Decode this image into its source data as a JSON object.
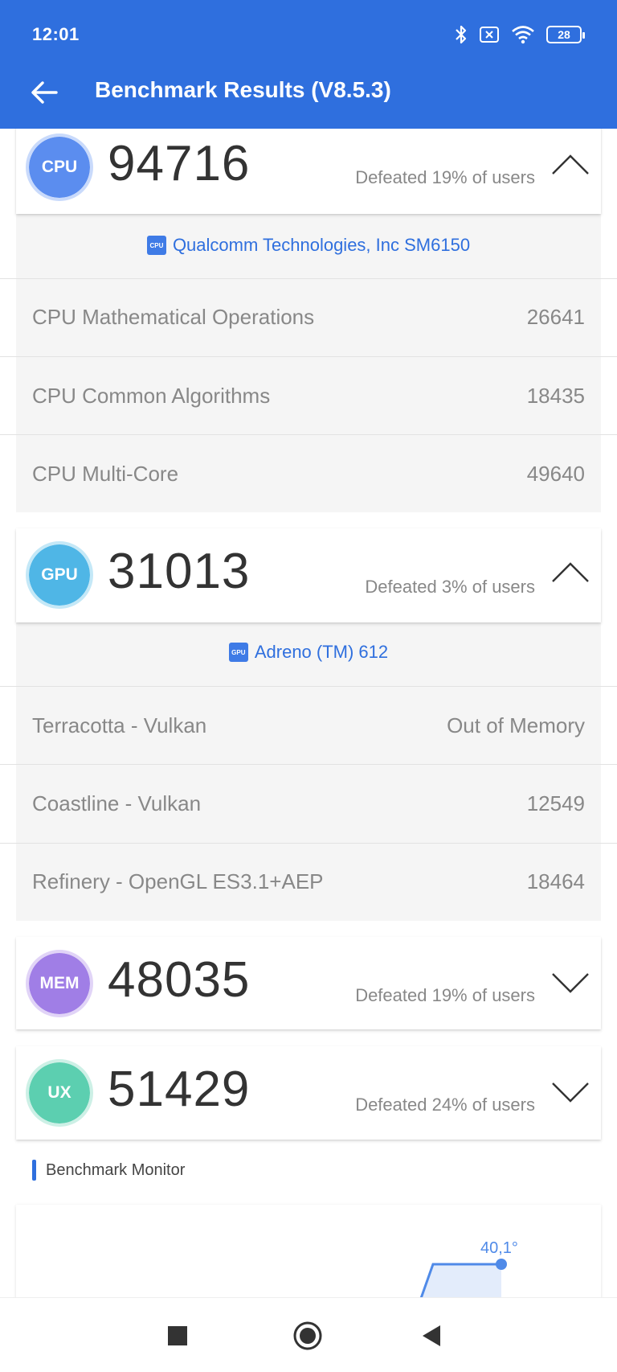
{
  "status_bar": {
    "time": "12:01",
    "battery": "28"
  },
  "app_bar": {
    "title": "Benchmark Results (V8.5.3)"
  },
  "cards": {
    "cpu": {
      "badge": "CPU",
      "score": "94716",
      "defeated": "Defeated 19% of users",
      "chip_name": "Qualcomm Technologies, Inc SM6150",
      "chip_icon_text": "CPU",
      "tests": [
        {
          "label": "CPU Mathematical Operations",
          "value": "26641"
        },
        {
          "label": "CPU Common Algorithms",
          "value": "18435"
        },
        {
          "label": "CPU Multi-Core",
          "value": "49640"
        }
      ]
    },
    "gpu": {
      "badge": "GPU",
      "score": "31013",
      "defeated": "Defeated 3% of users",
      "chip_name": "Adreno (TM) 612",
      "chip_icon_text": "GPU",
      "tests": [
        {
          "label": "Terracotta - Vulkan",
          "value": "Out of Memory"
        },
        {
          "label": "Coastline - Vulkan",
          "value": "12549"
        },
        {
          "label": "Refinery - OpenGL ES3.1+AEP",
          "value": "18464"
        }
      ]
    },
    "mem": {
      "badge": "MEM",
      "score": "48035",
      "defeated": "Defeated 19% of users"
    },
    "ux": {
      "badge": "UX",
      "score": "51429",
      "defeated": "Defeated 24% of users"
    }
  },
  "monitor": {
    "title": "Benchmark Monitor",
    "temperature_label": "40,1°"
  },
  "colors": {
    "app_bar": "#2f6fde",
    "cpu_badge": "#5b8def",
    "gpu_badge": "#4fb6e6",
    "mem_badge": "#a07ee6",
    "ux_badge": "#5ccfb0",
    "chart_line": "#4f8ae8"
  },
  "icons": [
    "back-arrow-icon",
    "bluetooth-icon",
    "sim-off-icon",
    "wifi-icon",
    "battery-icon",
    "chevron-up-icon",
    "chevron-down-icon",
    "chip-icon",
    "nav-recents-icon",
    "nav-home-icon",
    "nav-back-icon"
  ]
}
